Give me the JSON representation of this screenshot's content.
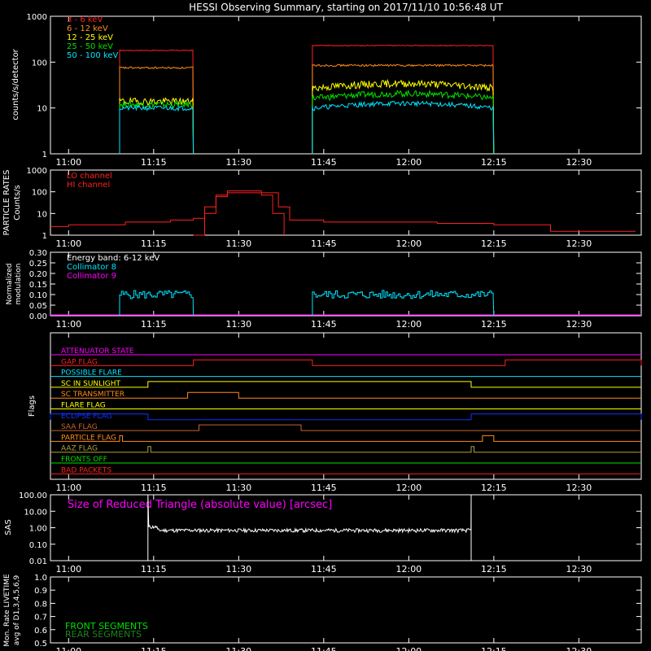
{
  "title": "HESSI Observing Summary, starting on 2017/11/10 10:56:48 UT",
  "time_axis": {
    "start": "10:56:48",
    "end": "12:41:00",
    "tick_labels": [
      "11:00",
      "11:15",
      "11:30",
      "11:45",
      "12:00",
      "12:15",
      "12:30"
    ],
    "tick_minutes": [
      660,
      675,
      690,
      705,
      720,
      735,
      750
    ]
  },
  "colors": {
    "background": "#000000",
    "axes": "#ffffff",
    "red": "#ff2020",
    "orange": "#ff8c1a",
    "yellow": "#ffff00",
    "green": "#00e000",
    "cyan": "#00e5ff",
    "magenta": "#ff00ff",
    "blue": "#1030ff",
    "olive": "#b0a040",
    "brown": "#c8642a"
  },
  "panels": {
    "lightcurves": {
      "ylabel": "counts/s/detector",
      "yticks": [
        "1",
        "10",
        "100",
        "1000"
      ],
      "legend": [
        {
          "label": "3 - 6 keV",
          "color": "#ff2020"
        },
        {
          "label": "6 - 12 keV",
          "color": "#ff8c1a"
        },
        {
          "label": "12 - 25 keV",
          "color": "#ffff00"
        },
        {
          "label": "25 - 50 keV",
          "color": "#00e000"
        },
        {
          "label": "50 - 100 keV",
          "color": "#00e5ff"
        }
      ]
    },
    "particles": {
      "ylabel1": "PARTICLE RATES",
      "ylabel2": "Counts/s",
      "yticks": [
        "1",
        "10",
        "100",
        "1000"
      ],
      "legend": [
        {
          "label": "LO channel",
          "color": "#ff2020"
        },
        {
          "label": "HI channel",
          "color": "#ff2020"
        }
      ]
    },
    "modulation": {
      "ylabel1": "Normalized",
      "ylabel2": "modulation",
      "yticks": [
        "0.00",
        "0.05",
        "0.10",
        "0.15",
        "0.20",
        "0.25",
        "0.30"
      ],
      "legend": [
        {
          "label": "Energy band: 6-12 keV",
          "color": "#ffffff"
        },
        {
          "label": "Collimator 8",
          "color": "#00e5ff"
        },
        {
          "label": "Collimator 9",
          "color": "#ff00ff"
        }
      ]
    },
    "flags": {
      "ylabel": "Flags",
      "items": [
        {
          "label": "ATTENUATOR STATE",
          "color": "#ff00ff"
        },
        {
          "label": "GAP FLAG",
          "color": "#ff2020"
        },
        {
          "label": "POSSIBLE FLARE",
          "color": "#00e5ff"
        },
        {
          "label": "SC IN SUNLIGHT",
          "color": "#ffff00"
        },
        {
          "label": "SC TRANSMITTER",
          "color": "#ff8c1a"
        },
        {
          "label": "FLARE FLAG",
          "color": "#ffff00"
        },
        {
          "label": "ECLIPSE FLAG",
          "color": "#1030ff"
        },
        {
          "label": "SAA FLAG",
          "color": "#c8642a"
        },
        {
          "label": "PARTICLE FLAG",
          "color": "#ff8c1a"
        },
        {
          "label": "AAZ FLAG",
          "color": "#b0a040"
        },
        {
          "label": "FRONTS OFF",
          "color": "#00e000"
        },
        {
          "label": "BAD PACKETS",
          "color": "#ff2020"
        }
      ]
    },
    "sas": {
      "ylabel": "SAS",
      "title": "Size of Reduced Triangle (absolute value) [arcsec]",
      "yticks": [
        "0.01",
        "0.10",
        "1.00",
        "10.00",
        "100.00"
      ]
    },
    "livetime": {
      "ylabel1": "Mon. Rate LIVETIME",
      "ylabel2": "avg of D1,3,4,5,6,9",
      "yticks": [
        "0.5",
        "0.6",
        "0.7",
        "0.8",
        "0.9",
        "1.0"
      ],
      "legend": [
        {
          "label": "FRONT SEGMENTS",
          "color": "#00e000"
        },
        {
          "label": "REAR SEGMENTS",
          "color": "#208020"
        }
      ]
    }
  },
  "chart_data": {
    "type": "line",
    "x_unit": "UT time",
    "lightcurve_series": [
      {
        "name": "3 - 6 keV",
        "segments": [
          {
            "start": "11:09",
            "end": "11:22",
            "value": 180
          },
          {
            "start": "11:43",
            "end": "12:15",
            "value": 230
          }
        ]
      },
      {
        "name": "6 - 12 keV",
        "segments": [
          {
            "start": "11:09",
            "end": "11:22",
            "value": 75
          },
          {
            "start": "11:43",
            "end": "12:15",
            "value": 85
          }
        ]
      },
      {
        "name": "12 - 25 keV",
        "segments": [
          {
            "start": "11:09",
            "end": "11:22",
            "value": 14
          },
          {
            "start": "11:43",
            "end": "12:15",
            "value": 30
          }
        ]
      },
      {
        "name": "25 - 50 keV",
        "segments": [
          {
            "start": "11:09",
            "end": "11:22",
            "value": 12
          },
          {
            "start": "11:43",
            "end": "12:15",
            "value": 18
          }
        ]
      },
      {
        "name": "50 - 100 keV",
        "segments": [
          {
            "start": "11:09",
            "end": "11:22",
            "value": 10
          },
          {
            "start": "11:43",
            "end": "12:15",
            "value": 11
          }
        ]
      }
    ],
    "particle_series": [
      {
        "name": "LO channel",
        "points": [
          [
            "10:56:48",
            2.5
          ],
          [
            "11:00",
            3
          ],
          [
            "11:05",
            3
          ],
          [
            "11:10",
            4
          ],
          [
            "11:18",
            5
          ],
          [
            "11:22",
            6
          ],
          [
            "11:24",
            20
          ],
          [
            "11:26",
            70
          ],
          [
            "11:28",
            110
          ],
          [
            "11:32",
            110
          ],
          [
            "11:34",
            90
          ],
          [
            "11:37",
            20
          ],
          [
            "11:39",
            5
          ],
          [
            "11:45",
            4
          ],
          [
            "11:55",
            4
          ],
          [
            "12:05",
            3.5
          ],
          [
            "12:15",
            3
          ],
          [
            "12:25",
            1.5
          ],
          [
            "12:40",
            1.5
          ]
        ]
      },
      {
        "name": "HI channel",
        "points": [
          [
            "11:22",
            1
          ],
          [
            "11:24",
            10
          ],
          [
            "11:26",
            60
          ],
          [
            "11:28",
            90
          ],
          [
            "11:32",
            90
          ],
          [
            "11:34",
            70
          ],
          [
            "11:36",
            10
          ],
          [
            "11:38",
            1
          ]
        ]
      }
    ],
    "modulation_series": [
      {
        "name": "Collimator 8",
        "segments": [
          {
            "start": "11:09",
            "end": "11:22",
            "value": 0.1
          },
          {
            "start": "11:43",
            "end": "12:15",
            "value": 0.1
          }
        ]
      },
      {
        "name": "Collimator 9",
        "value": 0.0
      }
    ],
    "flag_states": [
      {
        "name": "ATTENUATOR STATE",
        "high": []
      },
      {
        "name": "GAP FLAG",
        "high": [
          [
            "11:22",
            "11:43"
          ],
          [
            "12:17",
            "12:41"
          ]
        ]
      },
      {
        "name": "POSSIBLE FLARE",
        "high": []
      },
      {
        "name": "SC IN SUNLIGHT",
        "high": [
          [
            "11:14",
            "12:11"
          ]
        ]
      },
      {
        "name": "SC TRANSMITTER",
        "high": [
          [
            "11:21",
            "11:30"
          ]
        ]
      },
      {
        "name": "FLARE FLAG",
        "high": []
      },
      {
        "name": "ECLIPSE FLAG",
        "high": [
          [
            "10:56:48",
            "11:14"
          ],
          [
            "12:11",
            "12:41"
          ]
        ]
      },
      {
        "name": "SAA FLAG",
        "high": [
          [
            "11:23",
            "11:41"
          ]
        ]
      },
      {
        "name": "PARTICLE FLAG",
        "high": [
          [
            "11:09",
            "11:09:30"
          ],
          [
            "12:13",
            "12:15"
          ]
        ]
      },
      {
        "name": "AAZ FLAG",
        "high": [
          [
            "11:14",
            "11:14:30"
          ],
          [
            "12:11",
            "12:11:30"
          ]
        ]
      },
      {
        "name": "FRONTS OFF",
        "high": []
      },
      {
        "name": "BAD PACKETS",
        "high": []
      }
    ],
    "sas_series": {
      "name": "Size of Reduced Triangle",
      "start": "11:14",
      "end": "12:11",
      "value": 0.7
    },
    "livetime_series": []
  }
}
